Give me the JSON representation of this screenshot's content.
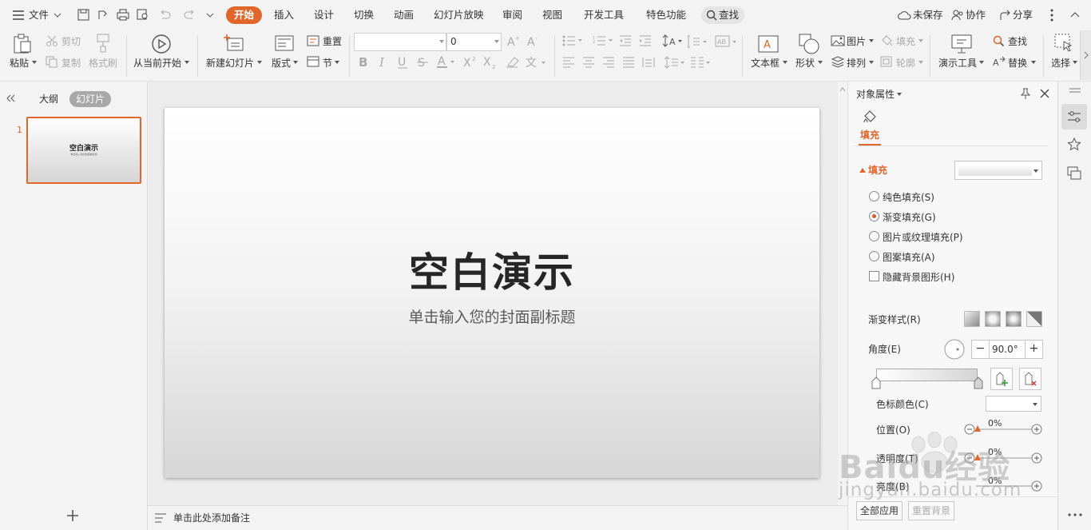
{
  "topbar": {
    "file_menu": "文件",
    "tabs": [
      "开始",
      "插入",
      "设计",
      "切换",
      "动画",
      "幻灯片放映",
      "审阅",
      "视图",
      "开发工具",
      "特色功能"
    ],
    "search": "查找",
    "unsaved": "未保存",
    "collaborate": "协作",
    "share": "分享"
  },
  "ribbon": {
    "paste": "粘贴",
    "cut": "剪切",
    "copy": "复制",
    "format_painter": "格式刷",
    "start_from_current": "从当前开始",
    "new_slide": "新建幻灯片",
    "layout": "版式",
    "reset": "重置",
    "section": "节",
    "font_name": "",
    "font_size": "0",
    "text_box": "文本框",
    "shape": "形状",
    "picture": "图片",
    "fill": "填充",
    "arrange": "排列",
    "outline": "轮廓",
    "presentation_tools": "演示工具",
    "find": "查找",
    "replace": "替换",
    "select": "选择"
  },
  "left_panel": {
    "tab_outline": "大纲",
    "tab_slides": "幻灯片",
    "slide_number": "1",
    "thumb_title": "空白演示",
    "thumb_subtitle": "单击输入您的封面副标题"
  },
  "slide": {
    "title": "空白演示",
    "subtitle": "单击输入您的封面副标题"
  },
  "notes": {
    "placeholder": "单击此处添加备注"
  },
  "panel": {
    "header": "对象属性",
    "tab_fill": "填充",
    "section_fill": "填充",
    "options": [
      "纯色填充(S)",
      "渐变填充(G)",
      "图片或纹理填充(P)",
      "图案填充(A)"
    ],
    "selected_option": 1,
    "hide_bg": "隐藏背景图形(H)",
    "gradient_style": "渐变样式(R)",
    "angle_label": "角度(E)",
    "angle_value": "90.0°",
    "stop_color": "色标颜色(C)",
    "position_label": "位置(O)",
    "position_value": "0%",
    "transparency_label": "透明度(T)",
    "transparency_value": "0%",
    "brightness_label": "亮度(B)",
    "brightness_value": "0%",
    "apply_all": "全部应用",
    "reset_bg": "重置背景"
  },
  "watermark": {
    "brand": "Baidu经验",
    "url": "jingyan.baidu.com"
  },
  "colors": {
    "accent": "#e0662a",
    "selected_border": "#e0662a"
  }
}
